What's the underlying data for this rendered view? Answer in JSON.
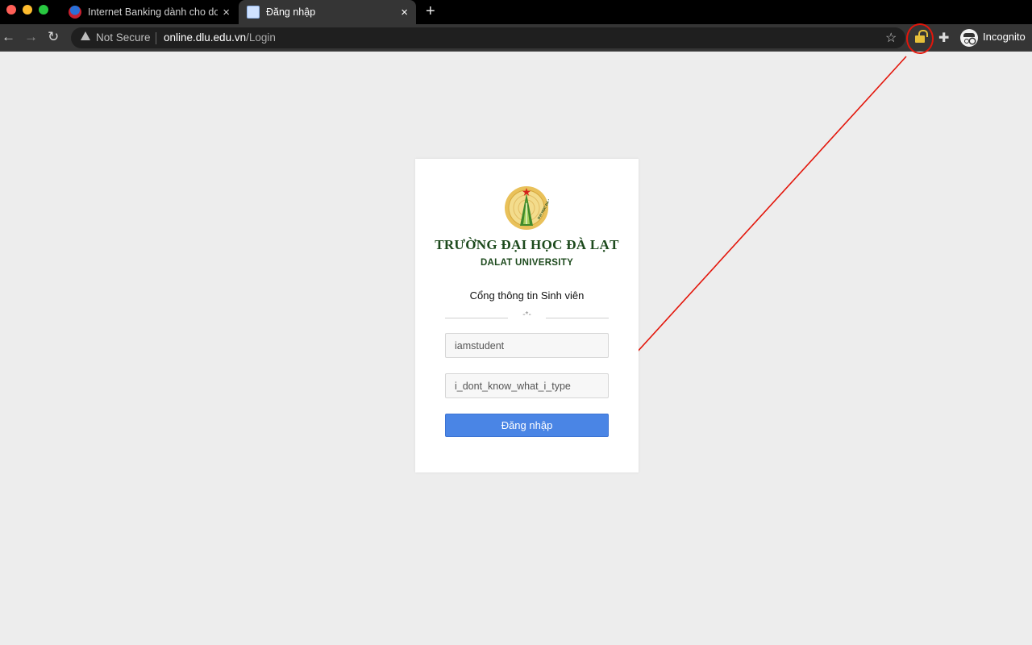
{
  "browser": {
    "tabs": [
      {
        "title": "Internet Banking dành cho doa",
        "active": false,
        "icon": "bank-favicon"
      },
      {
        "title": "Đăng nhập",
        "active": true,
        "icon": "page-favicon"
      }
    ],
    "new_tab_label": "+",
    "address": {
      "security_text": "Not Secure",
      "host": "online.dlu.edu.vn",
      "path": "/Login"
    },
    "profile_label": "Incognito",
    "icons": {
      "back": "←",
      "forward": "→",
      "reload": "↻",
      "star": "☆",
      "puzzle": "✚",
      "close": "×"
    }
  },
  "annotation": {
    "color": "#e3160b",
    "target": "unlocked-padlock-icon"
  },
  "login": {
    "university_vn": "TRƯỜNG ĐẠI HỌC ĐÀ LẠT",
    "university_en": "DALAT UNIVERSITY",
    "logo_text": "ĐẠI HỌC ĐÀ LẠT",
    "portal_title": "Cổng thông tin Sinh viên",
    "divider_mark": "-*-",
    "username_value": "iamstudent",
    "password_value": "i_dont_know_what_i_type",
    "submit_label": "Đăng nhập"
  },
  "colors": {
    "page_bg": "#ededed",
    "brand_green": "#1d4a1d",
    "button_blue": "#4a85e5"
  }
}
